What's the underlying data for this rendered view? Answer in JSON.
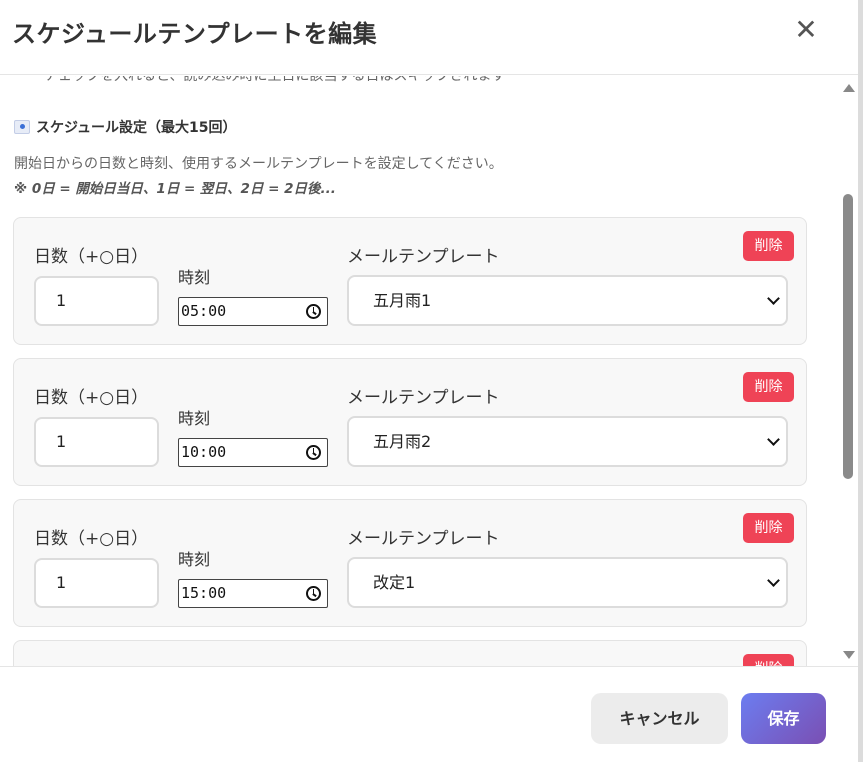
{
  "dialog": {
    "title": "スケジュールテンプレートを編集",
    "close_label": "✕"
  },
  "notice": {
    "text": "チェックを入れると、読み込み時に土日に該当する日はスキップされます"
  },
  "schedule": {
    "section_title": "スケジュール設定（最大15回）",
    "description": "開始日からの日数と時刻、使用するメールテンプレートを設定してください。",
    "example": "※ 0日 = 開始日当日、1日 = 翌日、2日 = 2日後...",
    "labels": {
      "days": "日数（+○日）",
      "time": "時刻",
      "template": "メールテンプレート",
      "delete": "削除"
    },
    "rows": [
      {
        "days": "1",
        "time": "05:00",
        "template": "五月雨1"
      },
      {
        "days": "1",
        "time": "10:00",
        "template": "五月雨2"
      },
      {
        "days": "1",
        "time": "15:00",
        "template": "改定1"
      },
      {
        "days": "",
        "time": "",
        "template": ""
      }
    ]
  },
  "footer": {
    "cancel_label": "キャンセル",
    "save_label": "保存"
  },
  "colors": {
    "delete_button": "#ef4356",
    "save_gradient_start": "#6c7df0",
    "save_gradient_end": "#7a4fb3"
  }
}
